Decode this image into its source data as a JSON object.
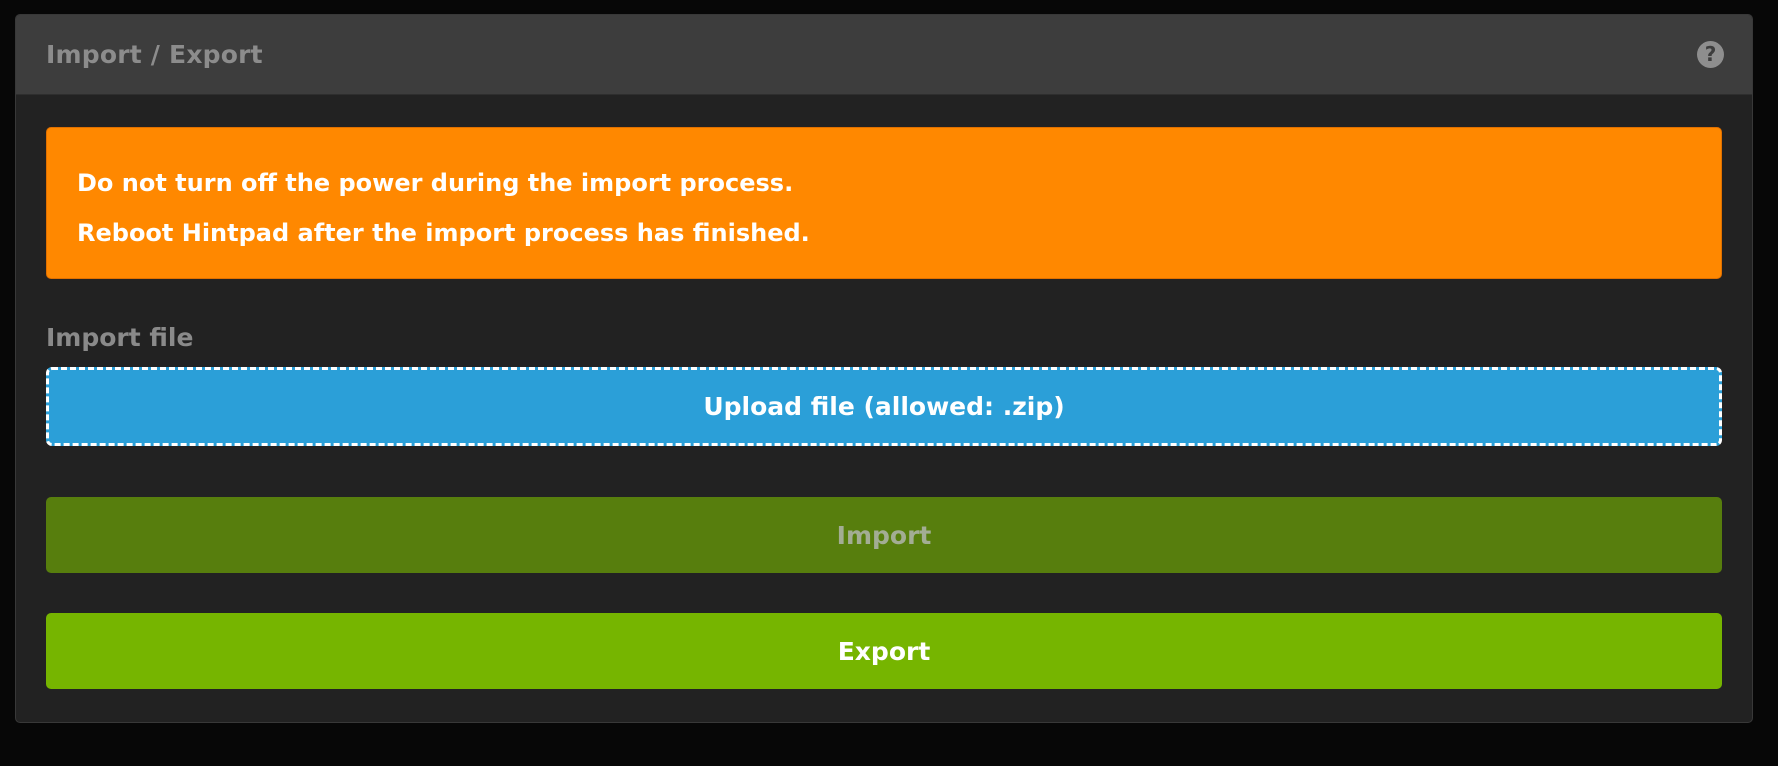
{
  "panel": {
    "title": "Import / Export",
    "help_icon": "question-circle-icon"
  },
  "alert": {
    "line1": "Do not turn off the power during the import process.",
    "line2": "Reboot Hintpad after the import process has finished.",
    "color": "#ff8800"
  },
  "import_file": {
    "label": "Import file",
    "upload_label": "Upload file (allowed: .zip)",
    "color": "#2b9fd8"
  },
  "buttons": {
    "import_label": "Import",
    "import_color": "#577e0d",
    "import_disabled": true,
    "export_label": "Export",
    "export_color": "#76b500"
  }
}
